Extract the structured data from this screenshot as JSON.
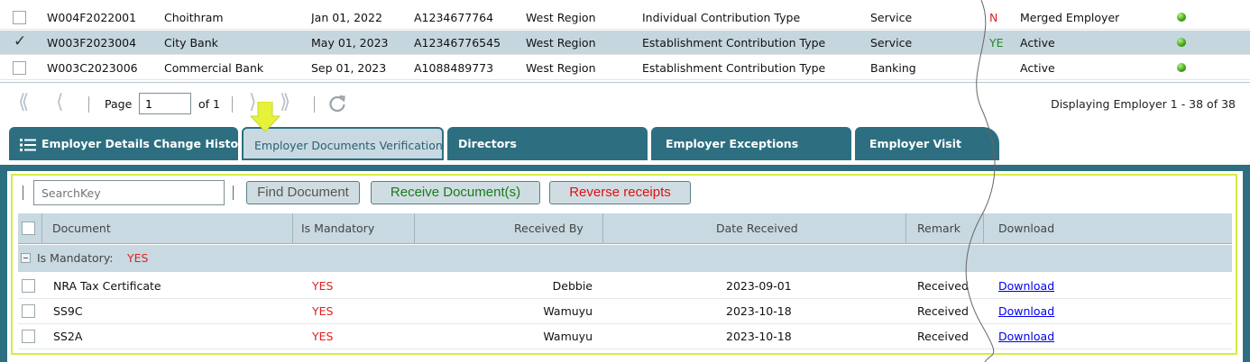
{
  "employers": [
    {
      "code": "W004F2022001",
      "name": "Choithram",
      "date": "Jan 01, 2022",
      "account": "A1234677764",
      "region": "West Region",
      "contribution_type": "Individual Contribution Type",
      "sector": "Service",
      "flag": "N",
      "status": "Merged Employer",
      "checked": false,
      "selected": false
    },
    {
      "code": "W003F2023004",
      "name": "City Bank",
      "date": "May 01, 2023",
      "account": "A12346776545",
      "region": "West Region",
      "contribution_type": "Establishment Contribution Type",
      "sector": "Service",
      "flag": "YE",
      "status": "Active",
      "checked": true,
      "selected": true
    },
    {
      "code": "W003C2023006",
      "name": "Commercial Bank",
      "date": "Sep 01, 2023",
      "account": "A1088489773",
      "region": "West Region",
      "contribution_type": "Establishment Contribution Type",
      "sector": "Banking",
      "flag": "",
      "status": "Active",
      "checked": false,
      "selected": false
    }
  ],
  "pager": {
    "page_label": "Page",
    "page_value": "1",
    "of_label": "of 1",
    "display_text": "Displaying Employer 1 - 38 of 38"
  },
  "tabs": [
    {
      "label": "Employer Details Change History"
    },
    {
      "label": "Employer Documents Verification"
    },
    {
      "label": "Directors"
    },
    {
      "label": "Employer Exceptions"
    },
    {
      "label": "Employer Visit"
    }
  ],
  "documents_panel": {
    "search_placeholder": "SearchKey",
    "find_button": "Find Document",
    "receive_button": "Receive Document(s)",
    "reverse_button": "Reverse receipts",
    "columns": [
      "Document",
      "Is Mandatory",
      "Received By",
      "Date Received",
      "Remark",
      "Download"
    ],
    "group_label": "Is Mandatory:",
    "group_value": "YES",
    "rows": [
      {
        "document": "NRA Tax Certificate",
        "mandatory": "YES",
        "received_by": "Debbie",
        "date_received": "2023-09-01",
        "remark": "Received",
        "download": "Download"
      },
      {
        "document": "SS9C",
        "mandatory": "YES",
        "received_by": "Wamuyu",
        "date_received": "2023-10-18",
        "remark": "Received",
        "download": "Download"
      },
      {
        "document": "SS2A",
        "mandatory": "YES",
        "received_by": "Wamuyu",
        "date_received": "2023-10-18",
        "remark": "Received",
        "download": "Download"
      }
    ]
  },
  "colors": {
    "tab_bg": "#2d6f80",
    "active_tab_bg": "#c8d9e1",
    "highlight_border": "#d7ec44",
    "status_led": "#3ea30f",
    "mandatory_text": "#e02020",
    "link": "#0000ee"
  },
  "icons": [
    "first-page-icon",
    "prev-page-icon",
    "next-page-icon",
    "last-page-icon",
    "refresh-icon",
    "list-icon",
    "status-led-icon",
    "pointer-arrow-icon"
  ]
}
